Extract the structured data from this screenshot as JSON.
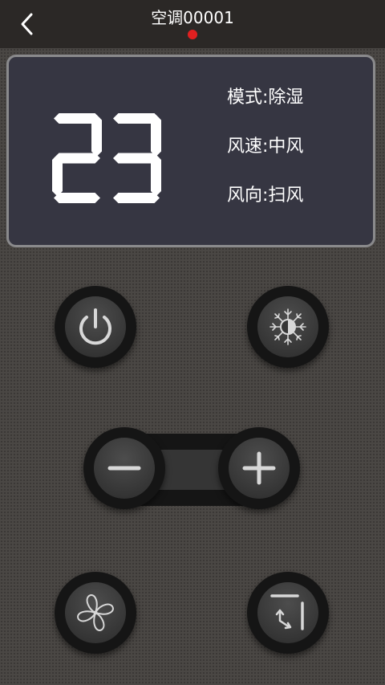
{
  "header": {
    "title": "空调00001",
    "status_dot_color": "#e02020",
    "back_icon": "chevron-left-icon"
  },
  "display": {
    "temperature": "23",
    "mode_line": "模式:除湿",
    "fan_speed_line": "风速:中风",
    "fan_direction_line": "风向:扫风"
  },
  "controls": {
    "power_icon": "power-icon",
    "mode_icon": "snowflake-sun-icon",
    "temp_down_icon": "minus-icon",
    "temp_up_icon": "plus-icon",
    "fan_speed_icon": "fan-icon",
    "swing_icon": "swing-icon"
  },
  "colors": {
    "background": "#4a4744",
    "titlebar": "#2b2826",
    "display_panel": "#363642",
    "icon": "#d8d8d8"
  }
}
